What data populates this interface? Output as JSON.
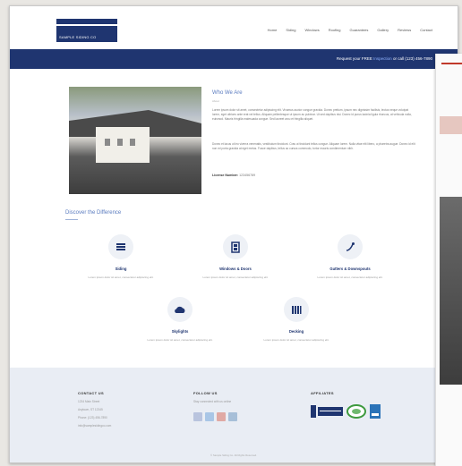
{
  "header": {
    "logo_text": "SAMPLE SIDING CO",
    "nav": [
      "Home",
      "Siding",
      "Windows",
      "Roofing",
      "Guarantees",
      "Gallery",
      "Reviews",
      "Contact"
    ]
  },
  "banner": {
    "prefix": "Request your FREE",
    "highlight": "Inspection",
    "middle": "or call",
    "phone": "(123) 456-7890"
  },
  "about": {
    "title": "Who We Are",
    "subtitle": "About",
    "para1": "Lorem ipsum dolor sit amet, consectetur adipiscing elit. Vivamus auctor congue gravida. Donec pretium, ipsum nec dignissim facilisis, lectus neque volutpat lorem, eget ultrices ante erat vel tellus. Aliquam pellentesque ut ipsum ac pulvinar. Ut sed dapibus nisi. Donec id purus lacinia ligula rhoncus, at vehicula nulla, euismod. Mauris fringilla malesuada congue. Sed laoreet arcu et fringilla aliquet.",
    "para2": "Donec et lacus ut leo viverra venenatis, vestibulum tincidunt. Cras ut tincidunt tellus congue. Aliquam lorem. Nulla vitae elit libero, a pharetra augue. Donec id elit non mi porta gravida at eget metus. Fusce dapibus, tellus ac cursus commodo, tortor mauris condimentum nibh.",
    "license_label": "License Number:",
    "license_value": "123456789"
  },
  "services": {
    "title": "Discover the Difference",
    "items": [
      {
        "name": "Siding",
        "desc": "Lorem ipsum dolor sit amet, consectetur adipiscing elit."
      },
      {
        "name": "Windows & Doors",
        "desc": "Lorem ipsum dolor sit amet, consectetur adipiscing elit."
      },
      {
        "name": "Gutters & Downspouts",
        "desc": "Lorem ipsum dolor sit amet, consectetur adipiscing elit."
      },
      {
        "name": "Skylights",
        "desc": "Lorem ipsum dolor sit amet, consectetur adipiscing elit."
      },
      {
        "name": "Decking",
        "desc": "Lorem ipsum dolor sit amet, consectetur adipiscing elit."
      }
    ]
  },
  "footer": {
    "contact_title": "CONTACT US",
    "contact_lines": [
      "1234 Main Street",
      "Anytown, ST 12345",
      "Phone: (123) 456-7890",
      "info@samplesidingco.com"
    ],
    "follow_title": "FOLLOW US",
    "follow_text": "Stay connected with us online",
    "affiliates_title": "AFFILIATES",
    "copyright": "© Sample Siding Co. All Rights Reserved."
  },
  "colors": {
    "brand": "#1f3570",
    "accent": "#5a7bbf"
  }
}
